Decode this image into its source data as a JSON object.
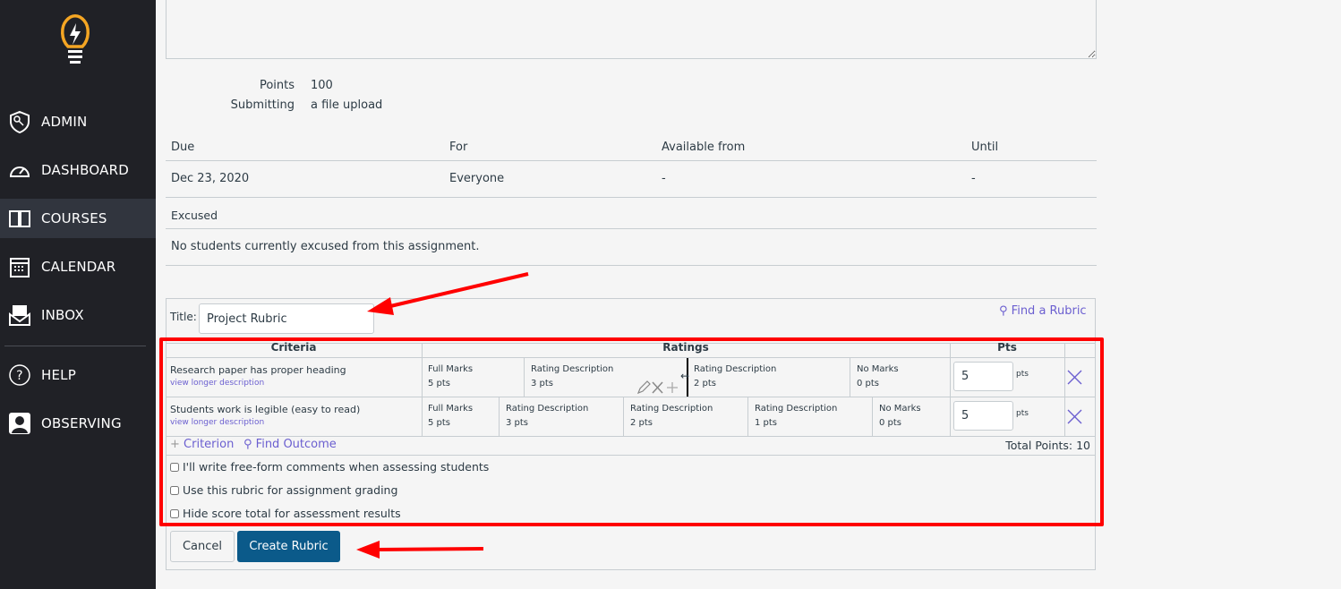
{
  "sidebar": {
    "items": [
      {
        "label": "ADMIN",
        "icon": "shield-key-icon"
      },
      {
        "label": "DASHBOARD",
        "icon": "speedometer-icon"
      },
      {
        "label": "COURSES",
        "icon": "book-icon",
        "active": true
      },
      {
        "label": "CALENDAR",
        "icon": "calendar-icon"
      },
      {
        "label": "INBOX",
        "icon": "inbox-icon"
      },
      {
        "label": "HELP",
        "icon": "help-icon"
      },
      {
        "label": "OBSERVING",
        "icon": "user-icon"
      }
    ]
  },
  "details": {
    "points_label": "Points",
    "points_value": "100",
    "submitting_label": "Submitting",
    "submitting_value": "a file upload"
  },
  "dates": {
    "headers": [
      "Due",
      "For",
      "Available from",
      "Until"
    ],
    "row": [
      "Dec 23, 2020",
      "Everyone",
      "-",
      "-"
    ]
  },
  "excused": {
    "label": "Excused",
    "text": "No students currently excused from this assignment."
  },
  "rubric": {
    "title_label": "Title:",
    "title_value": "Project Rubric",
    "find_rubric": "Find a Rubric",
    "headers": {
      "criteria": "Criteria",
      "ratings": "Ratings",
      "pts": "Pts"
    },
    "criteria": [
      {
        "name": "Research paper has proper heading",
        "link": "view longer description",
        "points": "5",
        "unit": "pts",
        "ratings": [
          {
            "d": "Full Marks",
            "p": "5 pts"
          },
          {
            "d": "Rating Description",
            "p": "3 pts"
          },
          {
            "d": "Rating Description",
            "p": "2 pts"
          },
          {
            "d": "No Marks",
            "p": "0 pts"
          }
        ]
      },
      {
        "name": "Students work is legible (easy to read)",
        "link": "view longer description",
        "points": "5",
        "unit": "pts",
        "ratings": [
          {
            "d": "Full Marks",
            "p": "5 pts"
          },
          {
            "d": "Rating Description",
            "p": "3 pts"
          },
          {
            "d": "Rating Description",
            "p": "2 pts"
          },
          {
            "d": "Rating Description",
            "p": "1 pts"
          },
          {
            "d": "No Marks",
            "p": "0 pts"
          }
        ]
      }
    ],
    "add_criterion": "Criterion",
    "find_outcome": "Find Outcome",
    "total": "Total Points: 10",
    "options": [
      "I'll write free-form comments when assessing students",
      "Use this rubric for assignment grading",
      "Hide score total for assessment results"
    ],
    "cancel": "Cancel",
    "create": "Create Rubric"
  },
  "colors": {
    "sidebar": "#202126",
    "accent": "#0b5a8a",
    "annotation": "#ff0000",
    "logo": "#f5a623"
  }
}
